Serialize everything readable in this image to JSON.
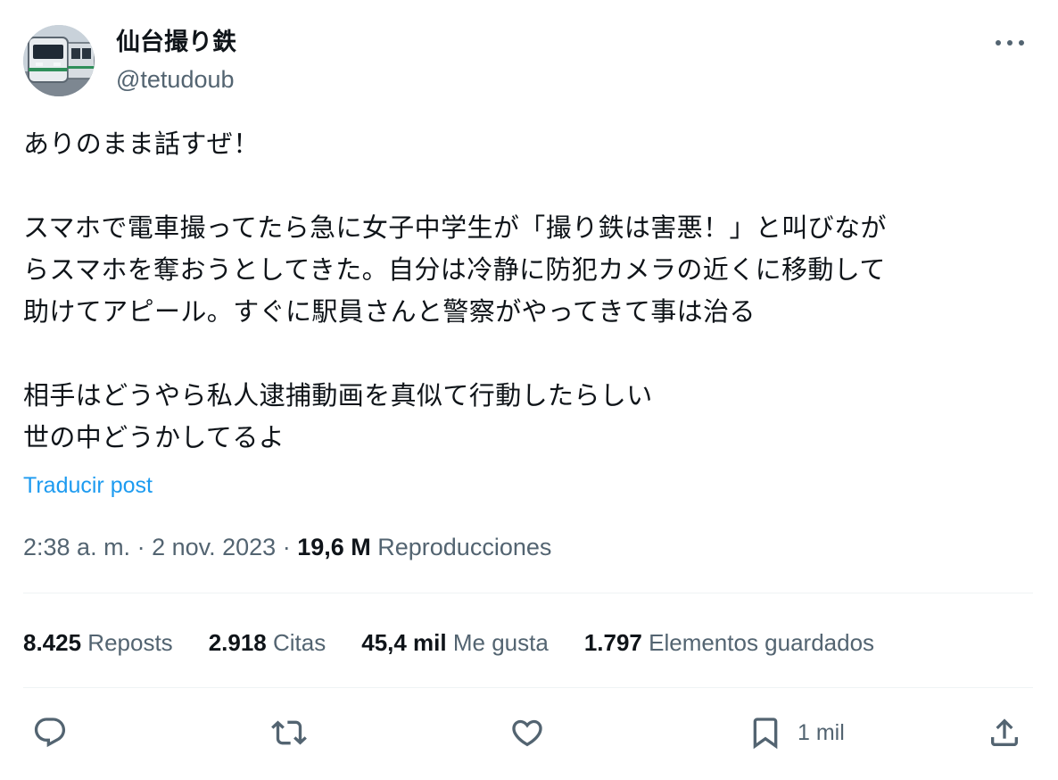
{
  "author": {
    "display_name": "仙台撮り鉄",
    "handle": "@tetudoub"
  },
  "tweet": {
    "text": "ありのまま話すぜ！\n\nスマホで電車撮ってたら急に女子中学生が「撮り鉄は害悪！」と叫びなが\nらスマホを奪おうとしてきた。自分は冷静に防犯カメラの近くに移動して\n助けてアピール。すぐに駅員さんと警察がやってきて事は治る\n\n相手はどうやら私人逮捕動画を真似て行動したらしい\n世の中どうかしてるよ",
    "translate_label": "Traducir post"
  },
  "meta": {
    "time": "2:38 a. m.",
    "separator1": " · ",
    "date": "2 nov. 2023",
    "separator2": " · ",
    "views_count": "19,6 M",
    "views_label": " Reproducciones"
  },
  "stats": {
    "reposts": {
      "count": "8.425",
      "label": " Reposts"
    },
    "quotes": {
      "count": "2.918",
      "label": " Citas"
    },
    "likes": {
      "count": "45,4 mil",
      "label": " Me gusta"
    },
    "bookmarks": {
      "count": "1.797",
      "label": " Elementos guardados"
    }
  },
  "actions": {
    "bookmark_count": "1 mil"
  },
  "icons": {
    "more": "more-horizontal-icon",
    "reply": "reply-icon",
    "repost": "repost-icon",
    "like": "heart-icon",
    "bookmark": "bookmark-icon",
    "share": "share-icon"
  },
  "colors": {
    "text_primary": "#0f1419",
    "text_secondary": "#536471",
    "link": "#1d9bf0",
    "divider": "#eff3f4"
  }
}
